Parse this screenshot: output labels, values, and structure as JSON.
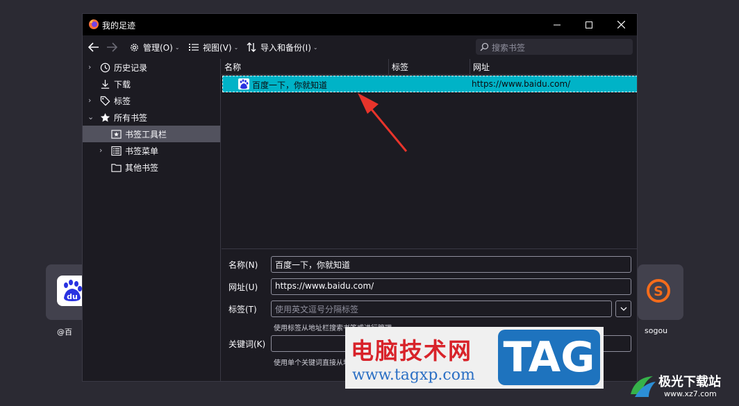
{
  "tiles": [
    {
      "label": "@百"
    },
    {
      "label": "sogou"
    }
  ],
  "window": {
    "title": "我的足迹",
    "controls": {
      "minimize": "—",
      "maximize": "☐",
      "close": "✕"
    }
  },
  "toolbar": {
    "back": "←",
    "forward": "→",
    "manage": "管理(O)",
    "view": "视图(V)",
    "import_backup": "导入和备份(I)",
    "search_placeholder": "搜索书签"
  },
  "tree": {
    "items": [
      {
        "label": "历史记录",
        "icon": "clock-icon"
      },
      {
        "label": "下载",
        "icon": "download-icon"
      },
      {
        "label": "标签",
        "icon": "tag-icon"
      },
      {
        "label": "所有书签",
        "icon": "star-icon"
      },
      {
        "label": "书签工具栏",
        "icon": "bookmark-toolbar-icon"
      },
      {
        "label": "书签菜单",
        "icon": "bookmark-menu-icon"
      },
      {
        "label": "其他书签",
        "icon": "folder-icon"
      }
    ]
  },
  "list": {
    "columns": [
      "名称",
      "标签",
      "网址"
    ],
    "rows": [
      {
        "name": "百度一下，你就知道",
        "tags": "",
        "url": "https://www.baidu.com/"
      }
    ]
  },
  "edit": {
    "name_label": "名称(N)",
    "name_value": "百度一下，你就知道",
    "url_label": "网址(U)",
    "url_value": "https://www.baidu.com/",
    "tags_label": "标签(T)",
    "tags_placeholder": "使用英文逗号分隔标签",
    "tags_hint": "使用标签从地址栏搜索书签或进行管理",
    "keyword_label": "关键词(K)",
    "keyword_value": "",
    "keyword_hint": "使用单个关键词直接从地址栏打开书签"
  },
  "overlay": {
    "watermark_cn": "电脑技术网",
    "watermark_url": "www.tagxp.com",
    "watermark_tag": "TAG",
    "logo_cn": "极光下载站",
    "logo_url": "www.xz7.com"
  },
  "colors": {
    "selection": "#00b3c7",
    "arrow": "#e8342b",
    "accent_orange": "#f56c1b",
    "baidu_blue": "#2932e1"
  }
}
